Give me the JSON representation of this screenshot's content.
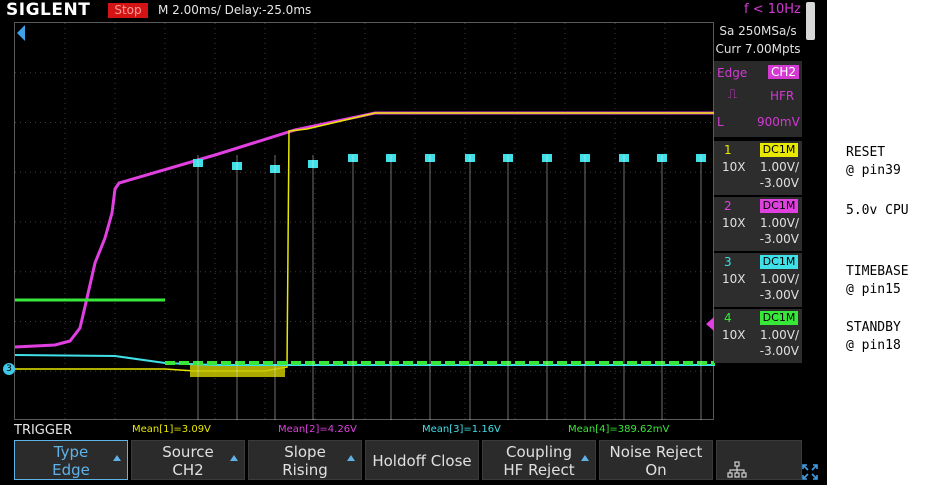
{
  "header": {
    "brand": "SIGLENT",
    "run_state": "Stop",
    "timebase": "M 2.00ms/ Delay:-25.0ms",
    "frequency": "f < 10Hz"
  },
  "acquisition": {
    "sample_rate": "Sa 250MSa/s",
    "memory": "Curr 7.00Mpts"
  },
  "trigger_panel": {
    "type": "Edge",
    "source": "CH2",
    "slope_icon": "rising-edge-icon",
    "coupling": "HFR",
    "level_label": "L",
    "level": "900mV"
  },
  "channels": [
    {
      "num": "1",
      "coupling": "DC1M",
      "probe": "10X",
      "scale": "1.00V/",
      "offset": "-3.00V",
      "color": "#e8e800"
    },
    {
      "num": "2",
      "coupling": "DC1M",
      "probe": "10X",
      "scale": "1.00V/",
      "offset": "-3.00V",
      "color": "#e040e0"
    },
    {
      "num": "3",
      "coupling": "DC1M",
      "probe": "10X",
      "scale": "1.00V/",
      "offset": "-3.00V",
      "color": "#40e0e8"
    },
    {
      "num": "4",
      "coupling": "DC1M",
      "probe": "10X",
      "scale": "1.00V/",
      "offset": "-3.00V",
      "color": "#38e838"
    }
  ],
  "measurements": {
    "label": "TRIGGER",
    "m1": "Mean[1]=3.09V",
    "m2": "Mean[2]=4.26V",
    "m3": "Mean[3]=1.16V",
    "m4": "Mean[4]=389.62mV"
  },
  "softkeys": [
    {
      "line1": "Type",
      "line2": "Edge"
    },
    {
      "line1": "Source",
      "line2": "CH2"
    },
    {
      "line1": "Slope",
      "line2": "Rising"
    },
    {
      "line1": "Holdoff Close",
      "line2": ""
    },
    {
      "line1": "Coupling",
      "line2": "HF Reject"
    },
    {
      "line1": "Noise Reject",
      "line2": "On"
    }
  ],
  "annotations": {
    "reset": "RESET\n@ pin39",
    "cpu": "5.0v CPU",
    "timebase": "TIMEBASE\n@ pin15",
    "standby": "STANDBY\n@ pin18"
  },
  "ground_marker": "3",
  "icons": [
    "trigger-position-icon",
    "channel-level-marker-icon",
    "network-icon",
    "fullscreen-icon"
  ]
}
